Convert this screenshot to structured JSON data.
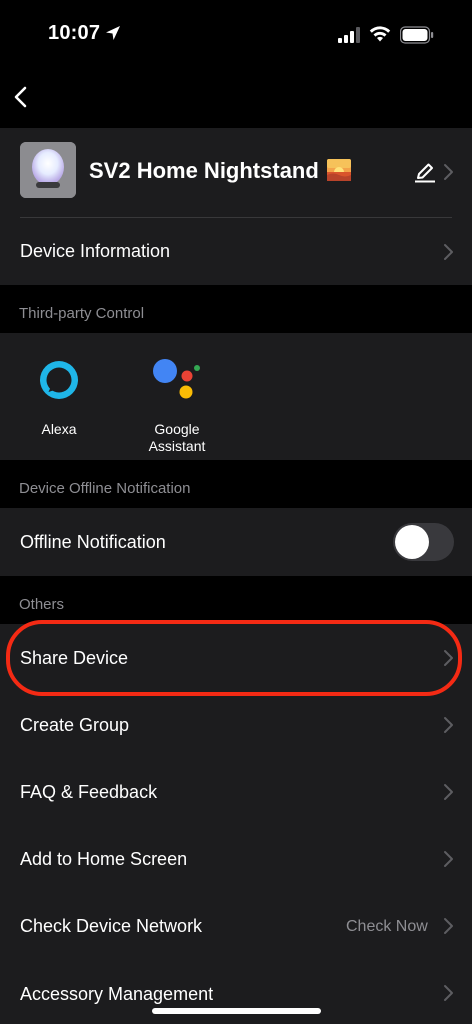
{
  "status_bar": {
    "time": "10:07",
    "icons": [
      "location-arrow-icon",
      "cellular-signal-icon",
      "wifi-icon",
      "battery-icon"
    ]
  },
  "nav": {
    "back_icon": "chevron-left-icon"
  },
  "device": {
    "name": "SV2 Home Nightstand",
    "emoji_icon": "sunset-emoji-icon",
    "edit_icon": "pencil-icon"
  },
  "device_information": {
    "label": "Device Information"
  },
  "third_party": {
    "section_title": "Third-party Control",
    "items": [
      {
        "label": "Alexa",
        "icon": "alexa-icon"
      },
      {
        "label": "Google\nAssistant",
        "icon": "google-assistant-icon"
      }
    ]
  },
  "offline": {
    "section_title": "Device Offline Notification",
    "label": "Offline Notification",
    "toggle_on": false
  },
  "others": {
    "section_title": "Others",
    "items": [
      {
        "label": "Share Device",
        "highlighted": true
      },
      {
        "label": "Create Group"
      },
      {
        "label": "FAQ & Feedback"
      },
      {
        "label": "Add to Home Screen"
      },
      {
        "label": "Check Device Network",
        "value": "Check Now"
      },
      {
        "label": "Accessory Management"
      }
    ]
  },
  "colors": {
    "background": "#000000",
    "row": "#1c1c1e",
    "section_text": "#8e8e93",
    "highlight": "#f42a14",
    "alexa": "#1fb6e8"
  }
}
